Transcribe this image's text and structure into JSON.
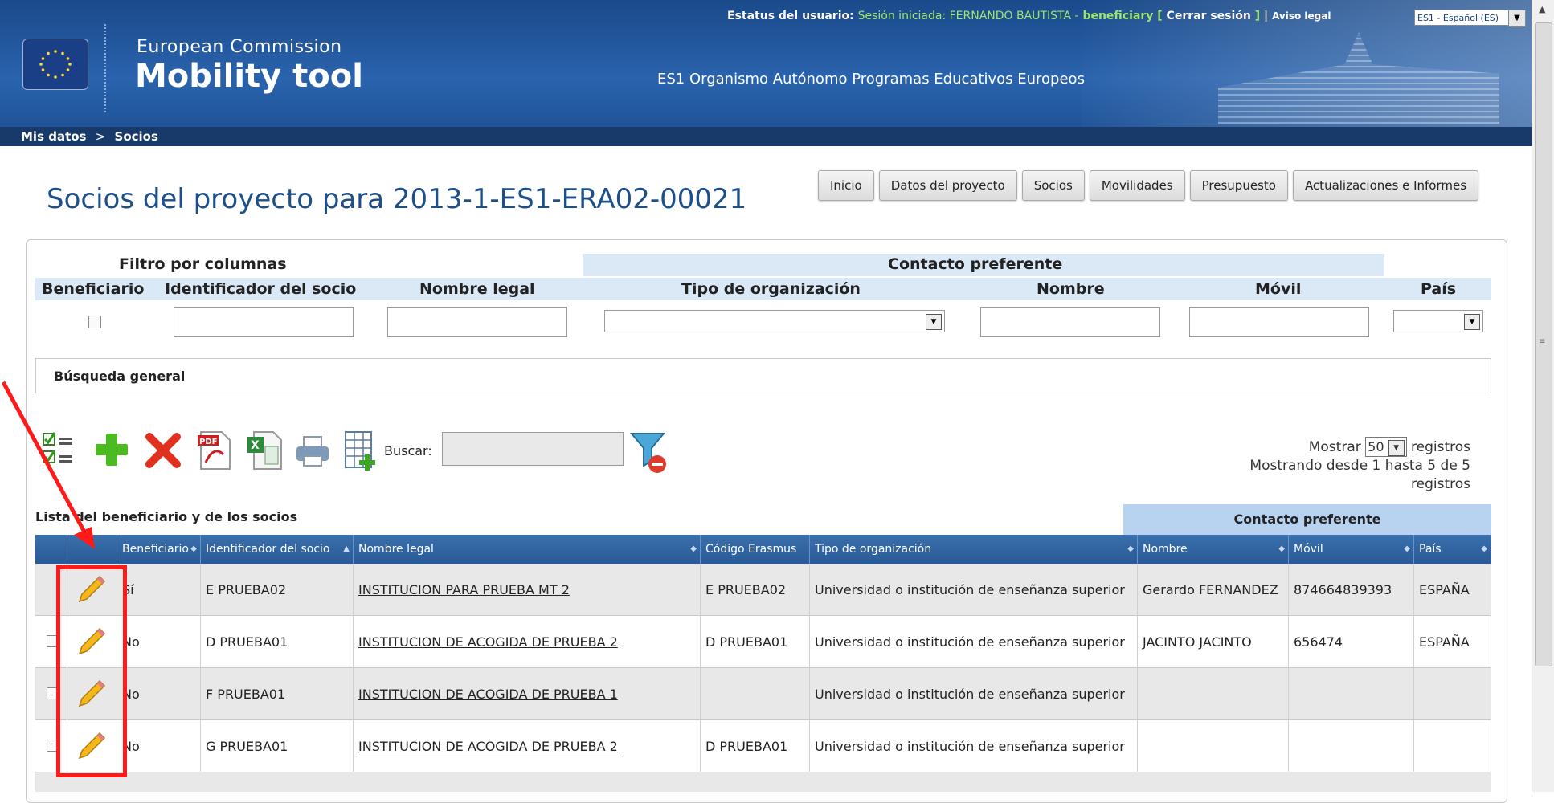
{
  "status": {
    "label": "Estatus del usuario:",
    "session": "Sesión iniciada: FERNANDO BAUTISTA -",
    "role": "beneficiary",
    "logout": "Cerrar sesión",
    "legal": "Aviso legal",
    "language": "ES1 - Español (ES)"
  },
  "header": {
    "ec": "European Commission",
    "app": "Mobility tool",
    "org": "ES1 Organismo Autónomo Programas Educativos Europeos"
  },
  "breadcrumb": {
    "item1": "Mis datos",
    "sep": ">",
    "item2": "Socios"
  },
  "page_title": "Socios del proyecto para 2013-1-ES1-ERA02-00021",
  "tabs": [
    "Inicio",
    "Datos del proyecto",
    "Socios",
    "Movilidades",
    "Presupuesto",
    "Actualizaciones e Informes"
  ],
  "filters": {
    "title": "Filtro por columnas",
    "contacto": "Contacto preferente",
    "cols": [
      "Beneficiario",
      "Identificador del socio",
      "Nombre legal",
      "Tipo de organización",
      "Nombre",
      "Móvil",
      "País"
    ],
    "general": "Búsqueda general"
  },
  "toolbar": {
    "buscar": "Buscar:",
    "mostrar": "Mostrar",
    "mostrar_value": "50",
    "registros": "registros",
    "showing_line1": "Mostrando desde 1 hasta 5 de 5",
    "showing_line2": "registros"
  },
  "table": {
    "title": "Lista del beneficiario y de los socios",
    "contacto": "Contacto preferente",
    "headers": [
      "Beneficiario",
      "Identificador del socio",
      "Nombre legal",
      "Código Erasmus",
      "Tipo de organización",
      "Nombre",
      "Móvil",
      "País"
    ],
    "rows": [
      {
        "benef": "Sí",
        "id": "E PRUEBA02",
        "nombre": "INSTITUCION PARA PRUEBA MT 2",
        "erasmus": "E PRUEBA02",
        "tipo": "Universidad o institución de enseñanza superior",
        "contacto": "Gerardo FERNANDEZ",
        "movil": "874664839393",
        "pais": "ESPAÑA"
      },
      {
        "benef": "No",
        "id": "D PRUEBA01",
        "nombre": "INSTITUCION DE ACOGIDA DE PRUEBA 2",
        "erasmus": "D PRUEBA01",
        "tipo": "Universidad o institución de enseñanza superior",
        "contacto": "JACINTO JACINTO",
        "movil": "656474",
        "pais": "ESPAÑA"
      },
      {
        "benef": "No",
        "id": "F PRUEBA01",
        "nombre": "INSTITUCION DE ACOGIDA DE PRUEBA 1",
        "erasmus": "",
        "tipo": "Universidad o institución de enseñanza superior",
        "contacto": "",
        "movil": "",
        "pais": ""
      },
      {
        "benef": "No",
        "id": "G PRUEBA01",
        "nombre": "INSTITUCION DE ACOGIDA DE PRUEBA 2",
        "erasmus": "D PRUEBA01",
        "tipo": "Universidad o institución de enseñanza superior",
        "contacto": "",
        "movil": "",
        "pais": ""
      }
    ]
  },
  "colors": {
    "header_blue": "#1f4f8f",
    "title_blue": "#1d4f8a",
    "highlight_red": "#ff1a1a",
    "table_head": "#2a5f9c"
  }
}
